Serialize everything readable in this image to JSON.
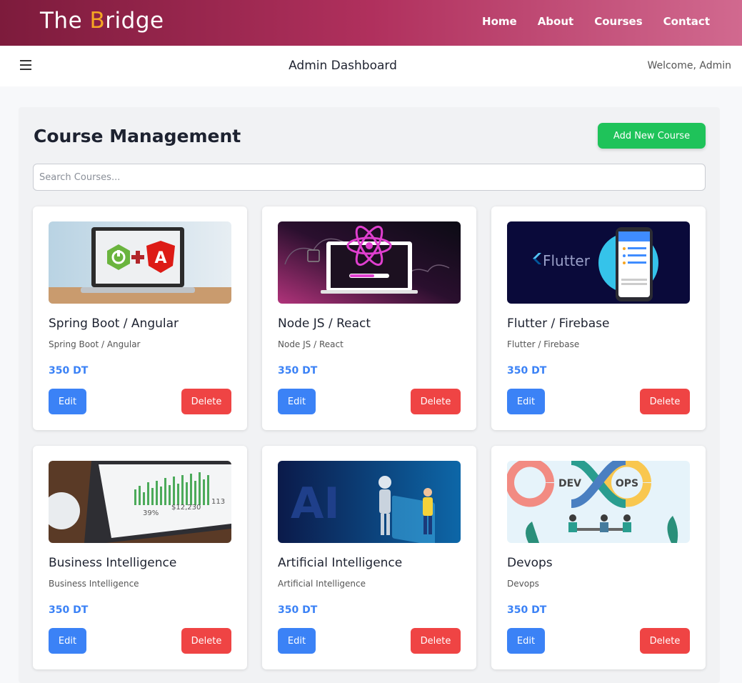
{
  "nav": {
    "logo_prefix": "The ",
    "logo_accent": "B",
    "logo_suffix": "ridge",
    "links": [
      "Home",
      "About",
      "Courses",
      "Contact"
    ]
  },
  "header": {
    "title": "Admin Dashboard",
    "welcome": "Welcome, Admin"
  },
  "main": {
    "title": "Course Management",
    "add_button": "Add New Course",
    "search_placeholder": "Search Courses..."
  },
  "courses": [
    {
      "title": "Spring Boot / Angular",
      "description": "Spring Boot / Angular",
      "price": "350 DT",
      "edit": "Edit",
      "delete": "Delete"
    },
    {
      "title": "Node JS / React",
      "description": "Node JS / React",
      "price": "350 DT",
      "edit": "Edit",
      "delete": "Delete"
    },
    {
      "title": "Flutter / Firebase",
      "description": "Flutter / Firebase",
      "price": "350 DT",
      "edit": "Edit",
      "delete": "Delete"
    },
    {
      "title": "Business Intelligence",
      "description": "Business Intelligence",
      "price": "350 DT",
      "edit": "Edit",
      "delete": "Delete"
    },
    {
      "title": "Artificial Intelligence",
      "description": "Artificial Intelligence",
      "price": "350 DT",
      "edit": "Edit",
      "delete": "Delete"
    },
    {
      "title": "Devops",
      "description": "Devops",
      "price": "350 DT",
      "edit": "Edit",
      "delete": "Delete"
    }
  ],
  "images": {
    "flutter_logo_text": "Flutter",
    "ai_text": "AI",
    "bi_values": [
      "39%",
      "$12,230",
      "113"
    ],
    "devops_left": "DEV",
    "devops_right": "OPS"
  },
  "colors": {
    "brand_gradient_start": "#7d1b3c",
    "brand_gradient_end": "#d1698f",
    "add_button": "#1fc35a",
    "edit_button": "#3b82f6",
    "delete_button": "#ef4444",
    "price": "#3b82f6"
  }
}
